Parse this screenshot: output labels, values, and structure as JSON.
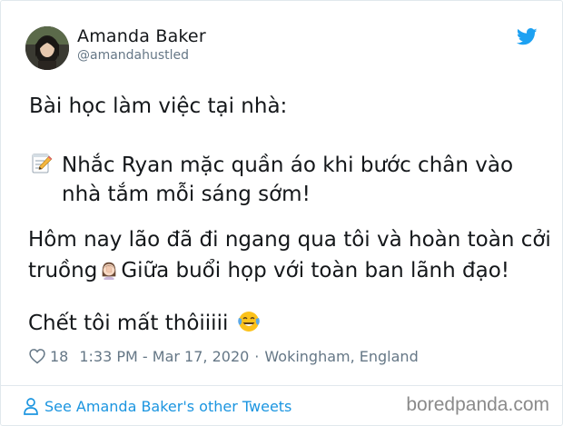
{
  "author": {
    "display_name": "Amanda Baker",
    "handle": "@amandahustled",
    "avatar_icon": "avatar-photo"
  },
  "tweet": {
    "line1": "Bài học làm việc tại nhà:",
    "memo_icon": "memo-icon",
    "line2": "Nhắc Ryan mặc quần áo khi bước chân vào",
    "line3": "nhà tắm mỗi sáng sớm!",
    "line4": "Hôm nay lão đã đi ngang qua tôi và hoàn toàn cởi",
    "line5_before": "truồng",
    "facepalm_icon": "woman-facepalming-icon",
    "line5_after": "Giữa buổi họp với toàn ban lãnh đạo!",
    "line6": "Chết tôi mất thôiiiii",
    "laugh_icon": "face-with-tears-of-joy-icon"
  },
  "meta": {
    "like_count": "18",
    "time": "1:33 PM - Mar 17, 2020",
    "separator": "·",
    "location": "Wokingham, England"
  },
  "footer": {
    "link_text": "See Amanda Baker's other Tweets",
    "watermark": "boredpanda.com"
  },
  "colors": {
    "twitter_blue": "#1da1f2",
    "link_blue": "#1b95e0",
    "secondary_text": "#657786",
    "primary_text": "#14171a",
    "border": "#e1e8ed"
  }
}
